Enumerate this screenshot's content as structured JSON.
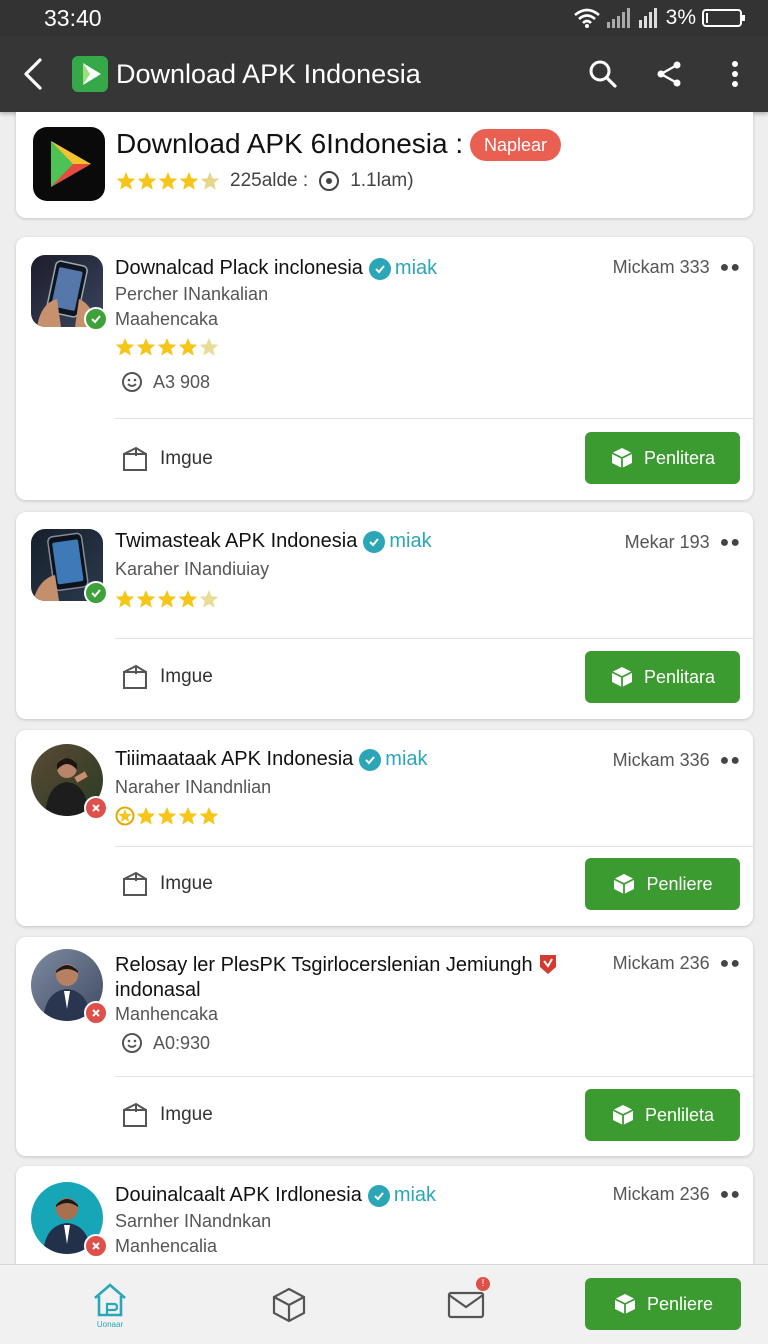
{
  "status_bar": {
    "time": "33:40",
    "battery": "3%"
  },
  "toolbar": {
    "title": "Download APK Indonesia"
  },
  "header": {
    "title": "Download APK 6Indonesia :",
    "badge": "Naplear",
    "rating_text": "225alde :",
    "time_text": "1.1lam)"
  },
  "apps": [
    {
      "name": "Downalcad Plack inclonesia",
      "verified": "miak",
      "sub1": "Percher INankalian",
      "sub2": "Maahencaka",
      "count": "A3 908",
      "right": "Mickam 333",
      "rating": 4.5,
      "secondary": "Imgue",
      "action": "Penlitera"
    },
    {
      "name": "Twimasteak APK Indonesia",
      "verified": "miak",
      "sub1": "Karaher INandiuiay",
      "right": "Mekar 193",
      "rating": 4.5,
      "secondary": "Imgue",
      "action": "Penlitara"
    },
    {
      "name": "Tiiimaataak APK Indonesia",
      "verified": "miak",
      "sub1": "Naraher INandnlian",
      "right": "Mickam 336",
      "rating": 4.5,
      "secondary": "Imgue",
      "action": "Penliere"
    },
    {
      "name": "Relosay ler PlesPK Tsgirlocerslenian Jemiungh",
      "name_line2": "indonasal",
      "sub1": "Manhencaka",
      "count": "A0:930",
      "right": "Mickam 236",
      "secondary": "Imgue",
      "action": "Penlileta"
    },
    {
      "name": "Douinalcaalt APK Irdlonesia",
      "verified": "miak",
      "sub1": "Sarnher INandnkan",
      "sub2": "Manhencalia",
      "right": "Mickam 236"
    }
  ],
  "bottom_nav": {
    "home_label": "Uonaar",
    "notification_count": "!",
    "action": "Penliere"
  },
  "colors": {
    "accent_green": "#3c9b30",
    "teal": "#2aa6b7",
    "badge_red": "#e95f52",
    "star": "#f5c518"
  }
}
